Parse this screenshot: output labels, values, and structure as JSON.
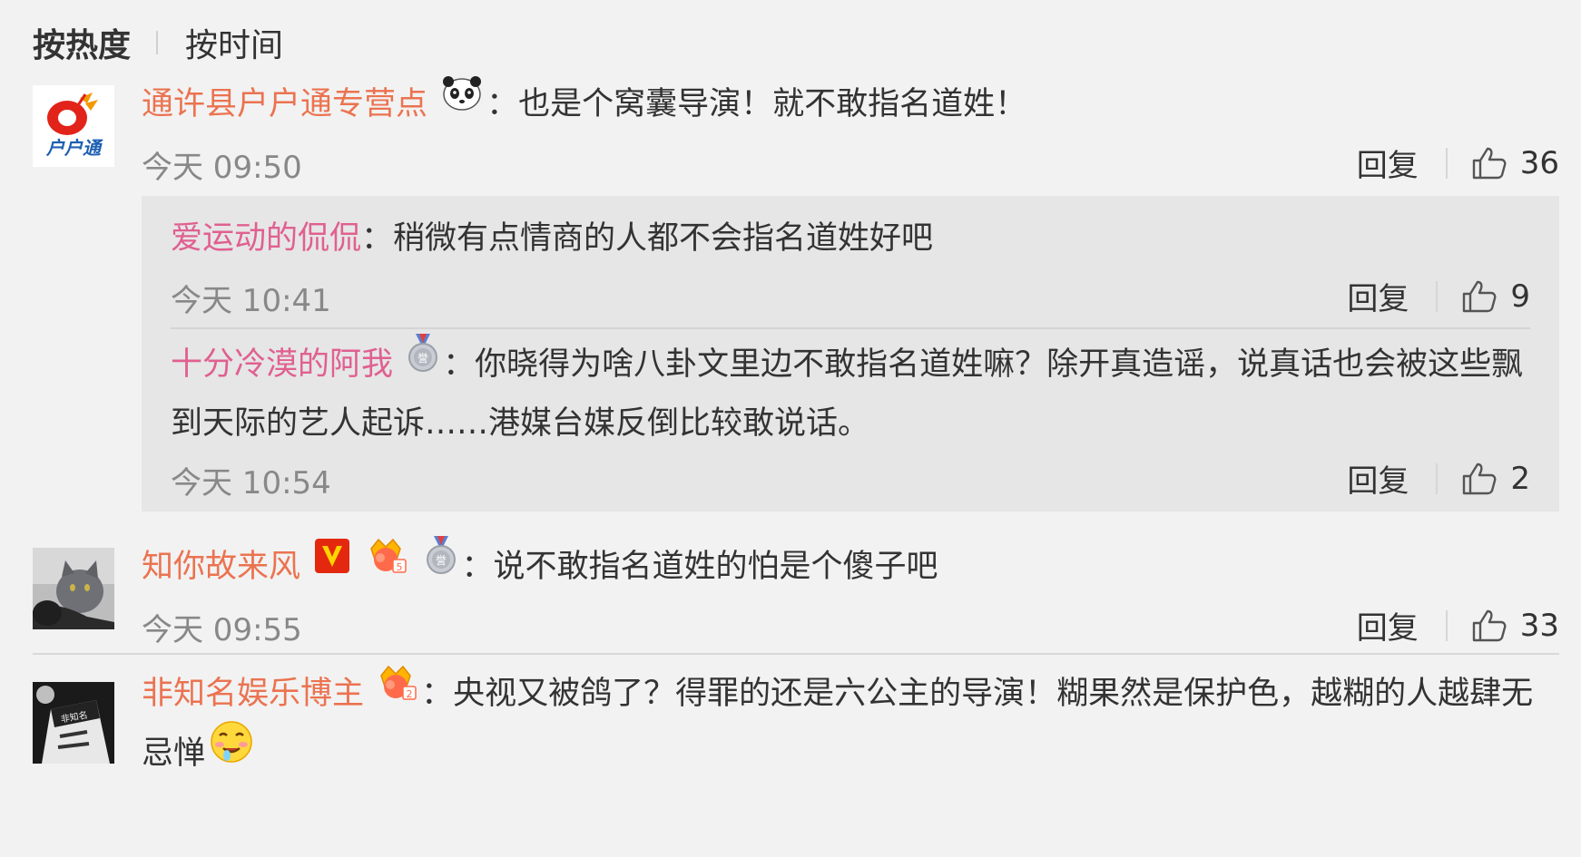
{
  "sort": {
    "hot_label": "按热度",
    "time_label": "按时间"
  },
  "comments": [
    {
      "username": "通许县户户通专营点",
      "avatar_text": "户户通",
      "text": "也是个窝囊导演！就不敢指名道姓！",
      "time": "今天 09:50",
      "reply_label": "回复",
      "likes": "36",
      "replies": [
        {
          "username": "爱运动的侃侃",
          "text": "稍微有点情商的人都不会指名道姓好吧",
          "time": "今天 10:41",
          "reply_label": "回复",
          "likes": "9"
        },
        {
          "username": "十分冷漠的阿我",
          "text": "你晓得为啥八卦文里边不敢指名道姓嘛？除开真造谣，说真话也会被这些飘到天际的艺人起诉……港媒台媒反倒比较敢说话。",
          "time": "今天 10:54",
          "reply_label": "回复",
          "likes": "2"
        }
      ]
    },
    {
      "username": "知你故来风",
      "text": "说不敢指名道姓的怕是个傻子吧",
      "time": "今天 09:55",
      "reply_label": "回复",
      "likes": "33"
    },
    {
      "username": "非知名娱乐博主",
      "text": "央视又被鸽了？得罪的还是六公主的导演！糊果然是保护色，越糊的人越肆无忌惮"
    }
  ],
  "colon": "：",
  "colors": {
    "username": "#eb7350",
    "background": "#f2f2f2",
    "reply_panel": "#e6e6e6"
  },
  "icons": [
    "panda-emoji-icon",
    "vip-v-icon",
    "crown-badge-icon",
    "medal-badge-icon",
    "thumbs-up-icon",
    "drooling-emoji-icon"
  ]
}
